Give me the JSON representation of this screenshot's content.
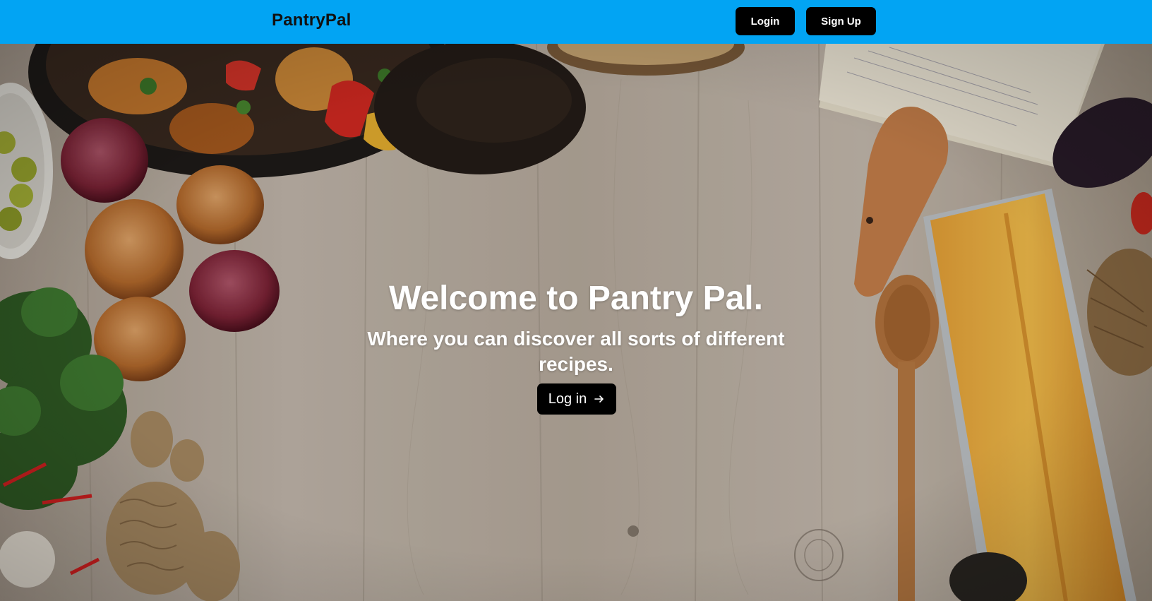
{
  "nav": {
    "brand": "PantryPal",
    "login_label": "Login",
    "signup_label": "Sign Up"
  },
  "hero": {
    "title": "Welcome to Pantry Pal.",
    "subtitle": "Where you can discover all sorts of different recipes.",
    "cta_label": "Log in",
    "cta_icon": "arrow-right-icon"
  },
  "colors": {
    "navbar_bg": "#02a4f3",
    "button_bg": "#000000",
    "button_text": "#ffffff",
    "hero_text": "#ffffff"
  }
}
